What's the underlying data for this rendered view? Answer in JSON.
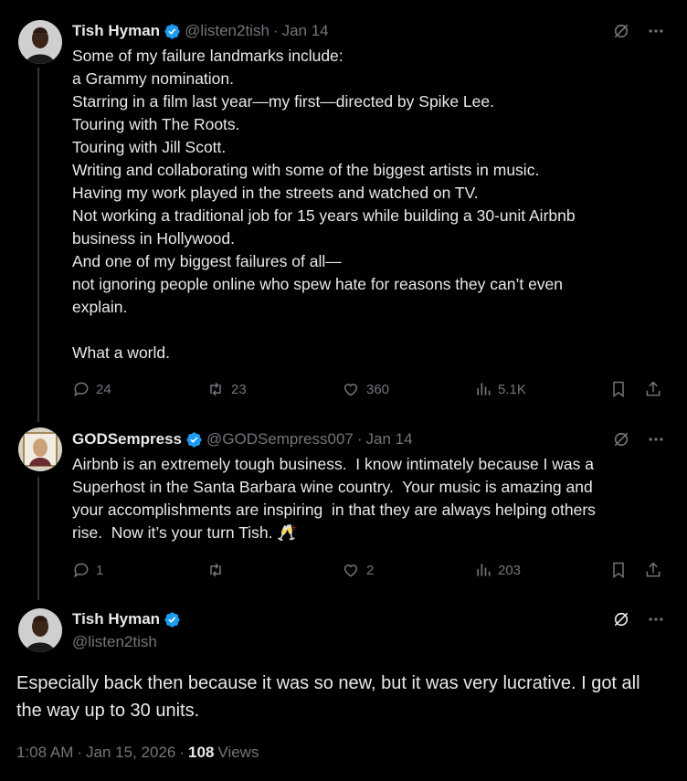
{
  "tweets": [
    {
      "name": "Tish Hyman",
      "handle": "@listen2tish",
      "separator": "·",
      "date": "Jan 14",
      "text": "Some of my failure landmarks include:\na Grammy nomination.\nStarring in a film last year—my first—directed by Spike Lee.\nTouring with The Roots.\nTouring with Jill Scott.\nWriting and collaborating with some of the biggest artists in music.\nHaving my work played in the streets and watched on TV.\nNot working a traditional job for 15 years while building a 30-unit Airbnb\nbusiness in Hollywood.\nAnd one of my biggest failures of all—\nnot ignoring people online who spew hate for reasons they can’t even\nexplain.\n\nWhat a world.",
      "replies": "24",
      "reposts": "23",
      "likes": "360",
      "views": "5.1K"
    },
    {
      "name": "GODSempress",
      "handle": "@GODSempress007",
      "separator": "·",
      "date": "Jan 14",
      "text": "Airbnb is an extremely tough business.  I know intimately because I was a\nSuperhost in the Santa Barbara wine country.  Your music is amazing and\nyour accomplishments are inspiring  in that they are always helping others\nrise.  Now it’s your turn Tish. 🥂",
      "replies": "1",
      "reposts": "",
      "likes": "2",
      "views": "203"
    }
  ],
  "main": {
    "name": "Tish Hyman",
    "handle": "@listen2tish",
    "text": "Especially back then because it was so new, but it was very lucrative. I got all the way up to 30 units.",
    "time": "1:08 AM",
    "separator": "·",
    "date": "Jan 15, 2026",
    "views_count": "108",
    "views_label": "Views"
  },
  "colors": {
    "background": "#000000",
    "text": "#e7e9ea",
    "muted": "#71767b",
    "verified": "#1d9bf0",
    "thread_line": "#333639"
  },
  "icons": [
    "grok-icon",
    "more-icon",
    "reply-icon",
    "repost-icon",
    "like-icon",
    "views-icon",
    "bookmark-icon",
    "share-icon",
    "verified-badge-icon"
  ]
}
